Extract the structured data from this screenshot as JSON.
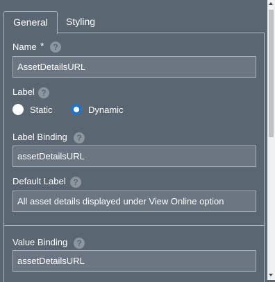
{
  "tabs": [
    {
      "label": "General",
      "active": true
    },
    {
      "label": "Styling",
      "active": false
    }
  ],
  "help_glyph": "?",
  "name": {
    "label": "Name",
    "required_marker": "*",
    "value": "AssetDetailsURL"
  },
  "label_section": {
    "label": "Label",
    "options": [
      {
        "label": "Static",
        "selected": false
      },
      {
        "label": "Dynamic",
        "selected": true
      }
    ]
  },
  "label_binding": {
    "label": "Label Binding",
    "value": "assetDetailsURL"
  },
  "default_label": {
    "label": "Default Label",
    "value": "All asset details displayed under View Online option"
  },
  "value_binding": {
    "label": "Value Binding",
    "value": "assetDetailsURL"
  },
  "colors": {
    "panel_bg": "#5a6672",
    "field_bg": "#6b7682",
    "radio_selected": "#1a77c9",
    "border": "#aeb6be"
  }
}
